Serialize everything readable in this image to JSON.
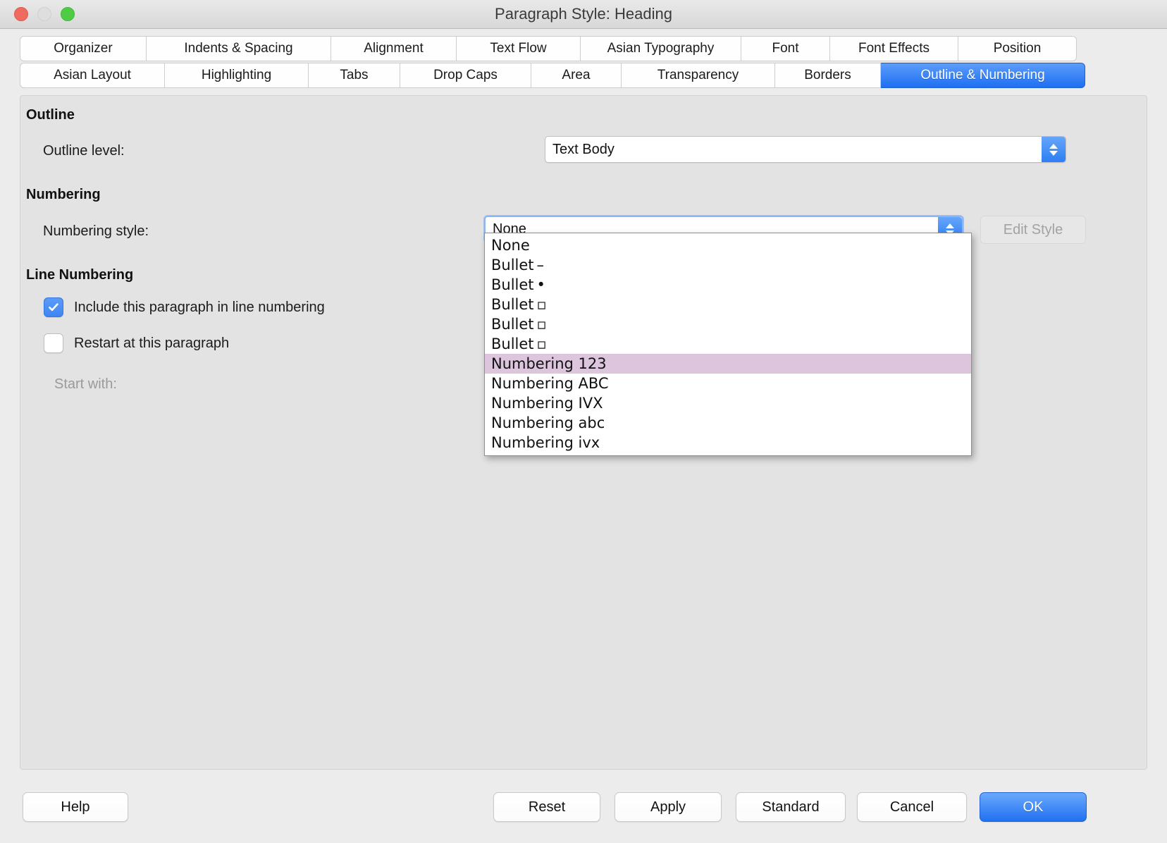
{
  "window": {
    "title": "Paragraph Style: Heading",
    "traffic_lights": [
      "close-button",
      "minimize-button",
      "maximize-button"
    ]
  },
  "tabs": {
    "row1": [
      {
        "label": "Organizer",
        "selected": false
      },
      {
        "label": "Indents & Spacing",
        "selected": false
      },
      {
        "label": "Alignment",
        "selected": false
      },
      {
        "label": "Text Flow",
        "selected": false
      },
      {
        "label": "Asian Typography",
        "selected": false
      },
      {
        "label": "Font",
        "selected": false
      },
      {
        "label": "Font Effects",
        "selected": false
      },
      {
        "label": "Position",
        "selected": false
      }
    ],
    "row2": [
      {
        "label": "Asian Layout",
        "selected": false
      },
      {
        "label": "Highlighting",
        "selected": false
      },
      {
        "label": "Tabs",
        "selected": false
      },
      {
        "label": "Drop Caps",
        "selected": false
      },
      {
        "label": "Area",
        "selected": false
      },
      {
        "label": "Transparency",
        "selected": false
      },
      {
        "label": "Borders",
        "selected": false
      },
      {
        "label": "Outline & Numbering",
        "selected": true
      }
    ]
  },
  "outline": {
    "group_title": "Outline",
    "level_label": "Outline level:",
    "level_value": "Text Body"
  },
  "numbering": {
    "group_title": "Numbering",
    "style_label": "Numbering style:",
    "style_value": "None",
    "edit_style_label": "Edit Style",
    "edit_style_enabled": false,
    "dropdown_open": true,
    "dropdown_highlight": "Numbering 123",
    "dropdown_items": [
      {
        "label": "None",
        "glyph": ""
      },
      {
        "label": "Bullet",
        "glyph": "–"
      },
      {
        "label": "Bullet",
        "glyph": "•"
      },
      {
        "label": "Bullet",
        "glyph": "▫"
      },
      {
        "label": "Bullet",
        "glyph": "▫"
      },
      {
        "label": "Bullet",
        "glyph": "▫"
      },
      {
        "label": "Numbering 123",
        "glyph": ""
      },
      {
        "label": "Numbering ABC",
        "glyph": ""
      },
      {
        "label": "Numbering IVX",
        "glyph": ""
      },
      {
        "label": "Numbering abc",
        "glyph": ""
      },
      {
        "label": "Numbering ivx",
        "glyph": ""
      }
    ]
  },
  "line_numbering": {
    "group_title": "Line Numbering",
    "include_label": "Include this paragraph in line numbering",
    "include_checked": true,
    "restart_label": "Restart at this paragraph",
    "restart_checked": false,
    "start_with_label": "Start with:",
    "start_with_enabled": false
  },
  "footer": {
    "help": "Help",
    "reset": "Reset",
    "apply": "Apply",
    "standard": "Standard",
    "cancel": "Cancel",
    "ok": "OK"
  },
  "colors": {
    "accent_blue": "#2171f0",
    "selected_tab": "#1e6ff2",
    "highlight_row": "#ddc5dd",
    "window_bg": "#ececec",
    "panel_bg": "#e3e3e3"
  }
}
